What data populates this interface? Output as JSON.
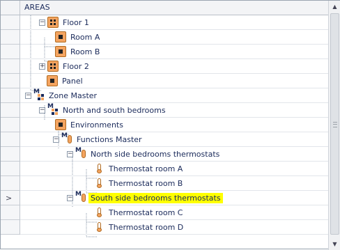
{
  "header": {
    "title": "AREAS"
  },
  "tree": [
    {
      "label": "Floor 1",
      "icon": "floor-icon",
      "expander": "minus"
    },
    {
      "label": "Room A",
      "icon": "room-icon"
    },
    {
      "label": "Room B",
      "icon": "room-icon"
    },
    {
      "label": "Floor 2",
      "icon": "floor-icon",
      "expander": "plus"
    },
    {
      "label": "Panel",
      "icon": "room-icon"
    },
    {
      "label": "Zone Master",
      "icon": "zone-master-icon",
      "expander": "minus"
    },
    {
      "label": "North and south bedrooms",
      "icon": "zone-master-icon",
      "expander": "minus"
    },
    {
      "label": "Environments",
      "icon": "room-icon"
    },
    {
      "label": "Functions Master",
      "icon": "functions-master-icon",
      "expander": "minus"
    },
    {
      "label": "North side bedrooms thermostats",
      "icon": "functions-master-icon",
      "expander": "minus"
    },
    {
      "label": "Thermostat room A",
      "icon": "thermostat-icon"
    },
    {
      "label": "Thermostat room B",
      "icon": "thermostat-icon"
    },
    {
      "label": "South side bedrooms thermostats",
      "icon": "functions-master-icon",
      "expander": "minus",
      "selected": true
    },
    {
      "label": "Thermostat room C",
      "icon": "thermostat-icon"
    },
    {
      "label": "Thermostat room D",
      "icon": "thermostat-icon"
    }
  ],
  "colors": {
    "selection": "#ffff00",
    "icon_orange": "#f4a460",
    "text": "#1a2a5a"
  }
}
